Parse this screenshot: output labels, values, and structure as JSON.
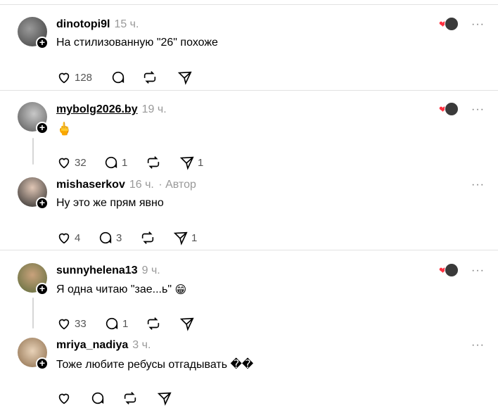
{
  "icons": {
    "like": "heart-icon",
    "reply": "comment-icon",
    "repost": "repost-icon",
    "share": "send-icon",
    "follow": "plus-icon",
    "more": "more-icon"
  },
  "colors": {
    "liked": "#ff3040",
    "muted": "#999999"
  },
  "posts": [
    {
      "username": "dinotopi9l",
      "time": "15 ч.",
      "text": "На стилизованную \"26\" похоже",
      "likes": "128",
      "replies": "",
      "reposts": "",
      "shares": ""
    },
    {
      "username": "mybolg2026.by",
      "time": "19 ч.",
      "text": "🖕",
      "likes": "32",
      "replies": "1",
      "reposts": "",
      "shares": "1"
    },
    {
      "username": "mishaserkov",
      "time": "16 ч.",
      "author_label": "· Автор",
      "text": "Ну это же прям явно",
      "likes": "4",
      "replies": "3",
      "reposts": "",
      "shares": "1"
    },
    {
      "username": "sunnyhelena13",
      "time": "9 ч.",
      "text": "Я одна читаю \"зае...ь\"",
      "emoji": "😁",
      "likes": "33",
      "replies": "1",
      "reposts": "",
      "shares": ""
    },
    {
      "username": "mriya_nadiya",
      "time": "3 ч.",
      "text": "Тоже любите ребусы отгадывать ��",
      "likes": "",
      "replies": "",
      "reposts": "",
      "shares": ""
    }
  ],
  "menu_label": "···"
}
